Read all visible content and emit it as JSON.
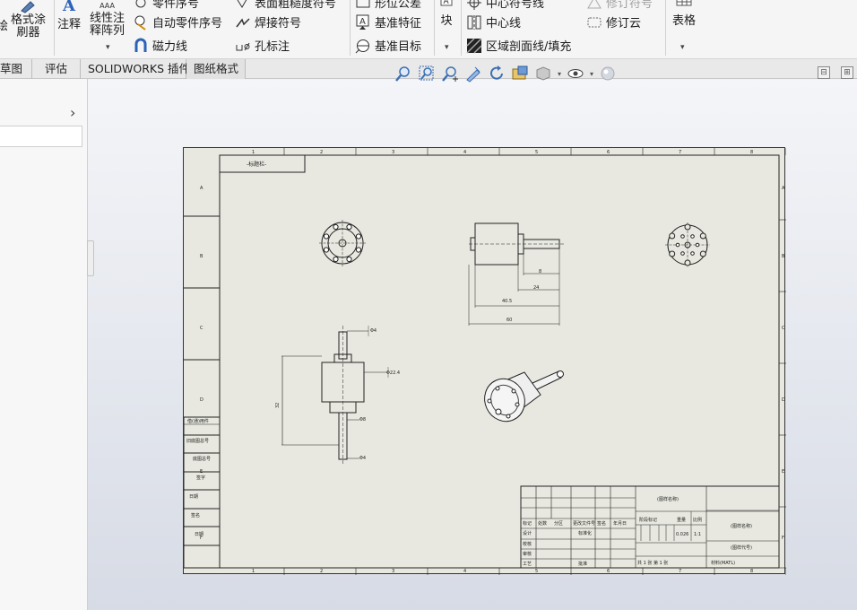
{
  "ribbon": {
    "left_group": {
      "label_line1": "格式涂",
      "label_line2": "刷器",
      "cut_label": "绘"
    },
    "annotation": {
      "label": "注释"
    },
    "linear_pattern": {
      "label_line1": "线性注",
      "label_line2": "释阵列"
    },
    "col1": [
      {
        "label": "零件序号",
        "icon": "balloon-icon"
      },
      {
        "label": "自动零件序号",
        "icon": "auto-balloon-icon"
      },
      {
        "label": "磁力线",
        "icon": "magnet-line-icon"
      }
    ],
    "col2": [
      {
        "label": "表面粗糙度符号",
        "icon": "surface-finish-icon"
      },
      {
        "label": "焊接符号",
        "icon": "weld-symbol-icon"
      },
      {
        "label": "孔标注",
        "icon": "hole-callout-icon"
      }
    ],
    "col3": [
      {
        "label": "形位公差",
        "icon": "geometric-tolerance-icon"
      },
      {
        "label": "基准特征",
        "icon": "datum-feature-icon"
      },
      {
        "label": "基准目标",
        "icon": "datum-target-icon"
      }
    ],
    "block": {
      "label": "块"
    },
    "col4": [
      {
        "label": "中心符号线",
        "icon": "center-mark-icon"
      },
      {
        "label": "中心线",
        "icon": "centerline-icon"
      },
      {
        "label": "区域剖面线/填充",
        "icon": "area-hatch-icon"
      }
    ],
    "col5": [
      {
        "label": "修订符号",
        "icon": "revision-symbol-icon"
      },
      {
        "label": "修订云",
        "icon": "revision-cloud-icon"
      }
    ],
    "table": {
      "label": "表格"
    }
  },
  "tabs": [
    {
      "label": "草图"
    },
    {
      "label": "评估"
    },
    {
      "label": "SOLIDWORKS 插件"
    },
    {
      "label": "图纸格式"
    }
  ],
  "view_toolbar": [
    "zoom-to-fit-icon",
    "zoom-to-area-icon",
    "zoom-in-out-icon",
    "select-icon",
    "rotate-icon",
    "section-view-icon",
    "display-style-icon",
    "hide-show-icon",
    "appearance-icon"
  ],
  "sheet": {
    "title_tab": "-标题栏-",
    "border_top_numbers": [
      "1",
      "2",
      "3",
      "4",
      "5",
      "6",
      "7",
      "8"
    ],
    "border_side_letters": [
      "A",
      "B",
      "C",
      "D",
      "E",
      "F"
    ],
    "left_strip_labels": [
      "借(通)用件",
      "旧底图总号",
      "底图总号",
      "签字",
      "日期",
      "签名",
      "日期"
    ],
    "dims": {
      "side_d1": "60",
      "side_d2": "40.5",
      "side_d3": "24",
      "side_d4": "8",
      "front_d1": "Φ4",
      "front_d2": "Φ22.4",
      "front_d3": "32",
      "front_d4": "Φ8",
      "front_d5": "Φ4"
    },
    "title_block": {
      "drawing_name": "(图样名称)",
      "drawing_code": "(图样代号)",
      "material": "材料(MATL)",
      "stage_label": "阶段标记",
      "weight_label": "重量",
      "scale_label": "比例",
      "scale_value": "1:1",
      "weight_value": "0.026",
      "sheet_info": "共 1 张  第 1 张",
      "rows": [
        "标记",
        "处数",
        "分区",
        "更改文件号",
        "签名",
        "年月日"
      ],
      "roles": [
        "设计",
        "校核",
        "审核",
        "工艺"
      ],
      "std": "标准化",
      "approve": "批准"
    }
  }
}
